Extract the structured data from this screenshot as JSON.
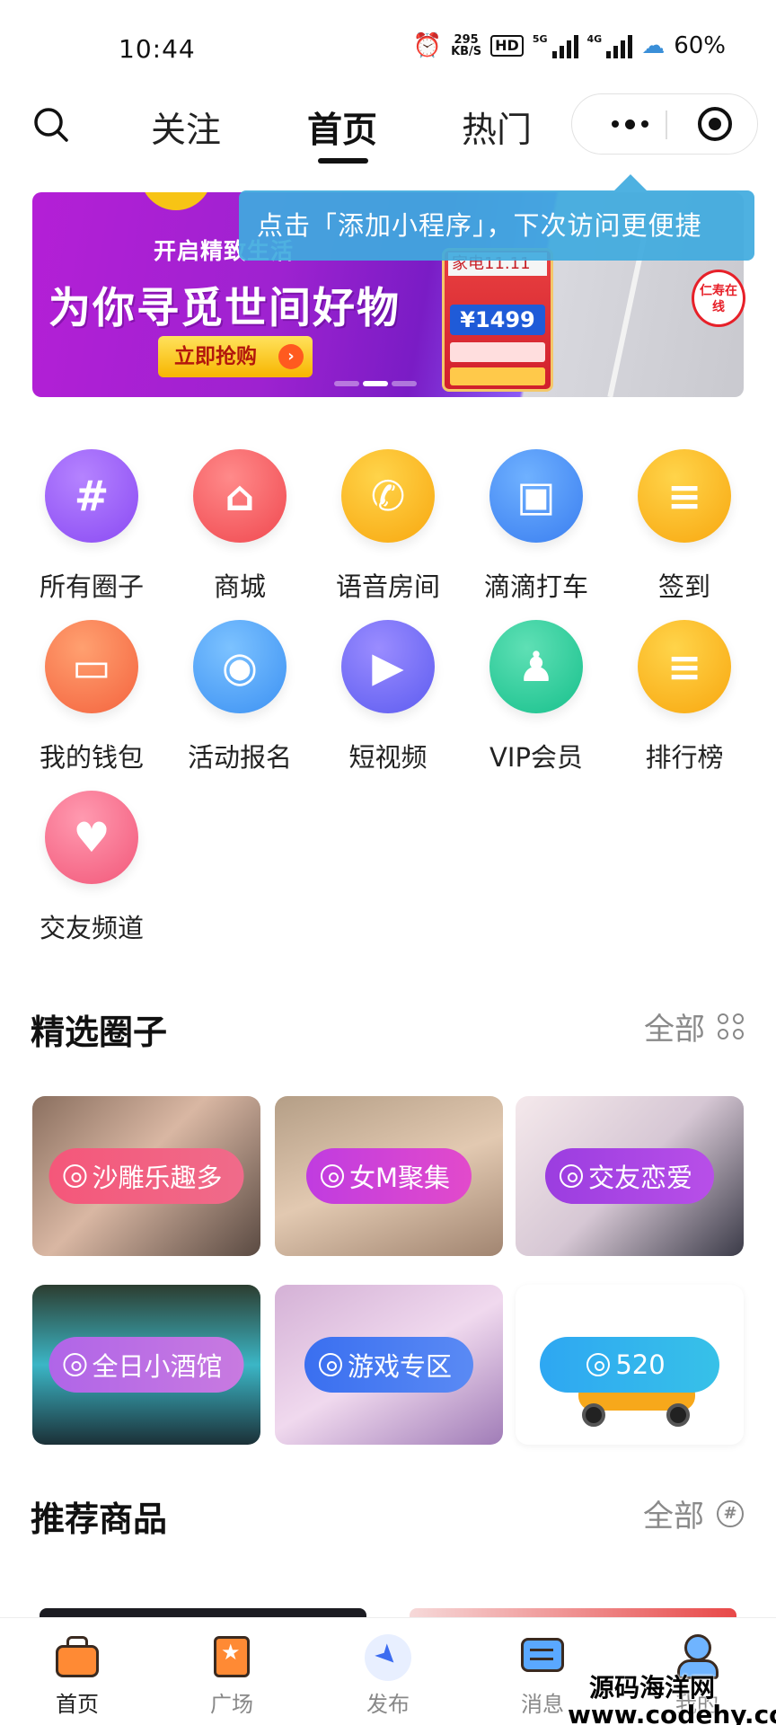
{
  "status_bar": {
    "time": "10:44",
    "net_speed": "295",
    "net_unit": "KB/S",
    "hd": "HD",
    "sig1": "5G",
    "sig2": "4G",
    "battery": "60%"
  },
  "nav": {
    "tabs": [
      "关注",
      "首页",
      "热门"
    ],
    "active_tab": "首页"
  },
  "tooltip": "点击「添加小程序」，下次访问更便捷",
  "banner": {
    "subtitle": "开启精致生活",
    "title": "为你寻觅世间好物",
    "button": "立即抢购",
    "card_tag": "家电11.11",
    "card_price": "¥1499",
    "badge": "仁寿在线"
  },
  "grid": [
    {
      "label": "所有圈子",
      "icon": "hashtag-icon",
      "glyph": "#"
    },
    {
      "label": "商城",
      "icon": "shopping-bag-icon",
      "glyph": "⌂"
    },
    {
      "label": "语音房间",
      "icon": "phone-note-icon",
      "glyph": "✆"
    },
    {
      "label": "滴滴打车",
      "icon": "car-icon",
      "glyph": "▣"
    },
    {
      "label": "签到",
      "icon": "document-icon",
      "glyph": "≡"
    },
    {
      "label": "我的钱包",
      "icon": "wallet-icon",
      "glyph": "▭"
    },
    {
      "label": "活动报名",
      "icon": "camera-icon",
      "glyph": "◉"
    },
    {
      "label": "短视频",
      "icon": "video-icon",
      "glyph": "▶"
    },
    {
      "label": "VIP会员",
      "icon": "person-icon",
      "glyph": "♟"
    },
    {
      "label": "排行榜",
      "icon": "ranking-icon",
      "glyph": "≡"
    },
    {
      "label": "交友频道",
      "icon": "hearts-icon",
      "glyph": "♥"
    }
  ],
  "featured": {
    "title": "精选圈子",
    "more": "全部",
    "circles": [
      "沙雕乐趣多",
      "女M聚集",
      "交友恋爱",
      "全日小酒馆",
      "游戏专区",
      "520"
    ]
  },
  "products": {
    "title": "推荐商品",
    "more": "全部"
  },
  "tabbar": {
    "items": [
      "首页",
      "广场",
      "发布",
      "消息",
      "我的"
    ],
    "active": "首页"
  },
  "watermark": {
    "line1": "源码海洋网",
    "line2": "www.codehy.com"
  }
}
